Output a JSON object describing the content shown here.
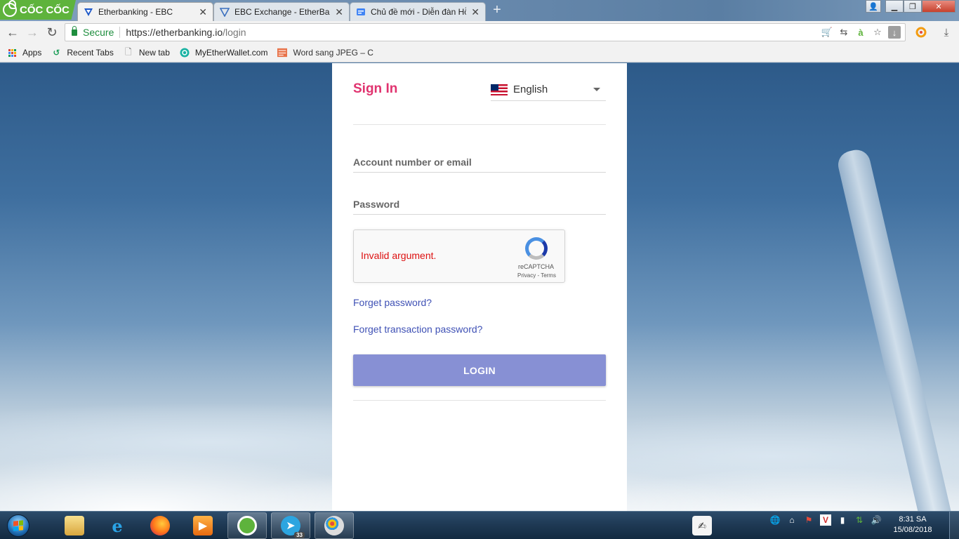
{
  "browser": {
    "brand": "CỐC CỐC",
    "tabs": [
      {
        "label": "Etherbanking - EBC",
        "active": true
      },
      {
        "label": "EBC Exchange - EtherBanki",
        "active": false
      },
      {
        "label": "Chủ đề mới - Diễn đàn Hỗ",
        "active": false
      }
    ],
    "new_tab_symbol": "+",
    "security_label": "Secure",
    "url_host": "https://etherbanking.io",
    "url_path": "/login",
    "bookmarks": [
      {
        "label": "Apps",
        "icon": "apps-grid-icon"
      },
      {
        "label": "Recent Tabs",
        "icon": "recent-tabs-icon"
      },
      {
        "label": "New tab",
        "icon": "page-icon"
      },
      {
        "label": "MyEtherWallet.com",
        "icon": "myetherwallet-icon"
      },
      {
        "label": "Word sang JPEG – C",
        "icon": "doc-jpg-icon"
      }
    ]
  },
  "login": {
    "title": "Sign In",
    "language": "English",
    "account_placeholder": "Account number or email",
    "password_placeholder": "Password",
    "recaptcha_error": "Invalid argument.",
    "recaptcha_brand": "reCAPTCHA",
    "recaptcha_links": "Privacy - Terms",
    "forget_password": "Forget password?",
    "forget_transaction_password": "Forget transaction password?",
    "login_button": "LOGIN"
  },
  "colors": {
    "title": "#e0336f",
    "link": "#3f51b5",
    "login_button": "#8790d4",
    "recaptcha_error": "#dd1111"
  },
  "taskbar": {
    "telegram_badge": "33",
    "time": "8:31 SA",
    "date": "15/08/2018"
  }
}
